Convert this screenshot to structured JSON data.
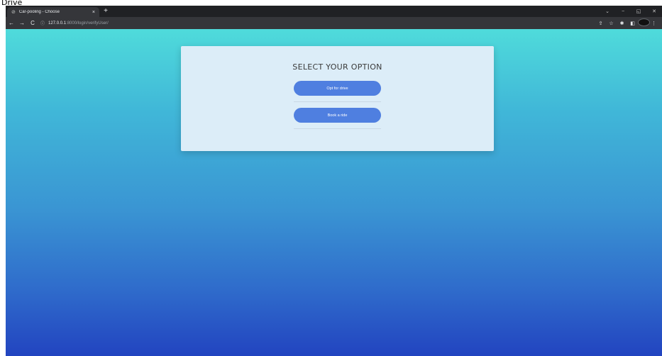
{
  "caption": "Drive",
  "browser": {
    "tab_title": "Car-pooling - Choose",
    "tab_close": "×",
    "new_tab": "+",
    "url_host": "127.0.0.1",
    "url_path": ":8000/login/verifyUser/"
  },
  "page": {
    "heading": "SELECT YOUR OPTION",
    "options": [
      {
        "label": "Opt for drive"
      },
      {
        "label": "Book a ride"
      }
    ]
  },
  "colors": {
    "gradient_top": "#4fdbdb",
    "gradient_bottom": "#2244c0",
    "card_bg": "#dcedf8",
    "button_bg": "#4f7fe0"
  }
}
